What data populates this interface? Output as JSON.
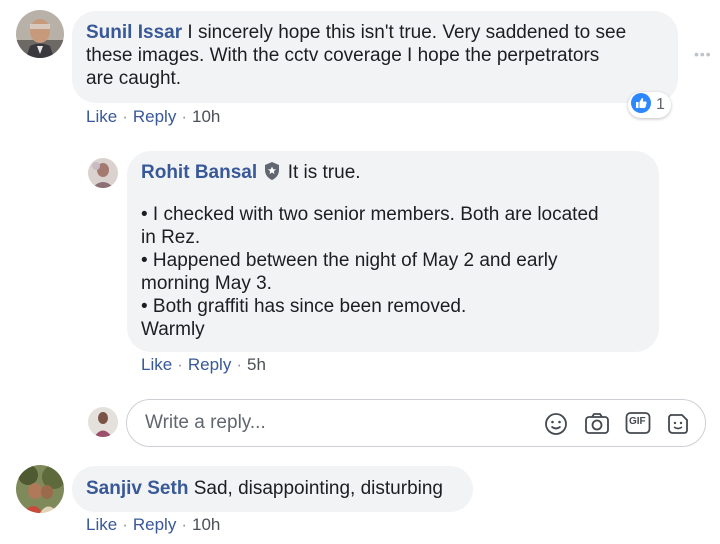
{
  "comments": [
    {
      "author": "Sunil Issar",
      "lines": [
        "I sincerely hope this isn't true. Very saddened to see",
        "these images. With the cctv coverage I hope the perpetrators",
        "are caught."
      ],
      "like": "Like",
      "reply": "Reply",
      "time": "10h",
      "reaction_count": "1"
    },
    {
      "author": "Sanjiv Seth",
      "text": "Sad, disappointing, disturbing",
      "like": "Like",
      "reply": "Reply",
      "time": "10h"
    }
  ],
  "reply": {
    "author": "Rohit Bansal",
    "first_text": "It is true.",
    "lines": [
      "• I checked with two senior members. Both are located",
      "in Rez.",
      "• Happened between the night of May 2 and early",
      "morning May 3.",
      "• Both graffiti has since been removed.",
      "Warmly"
    ],
    "like": "Like",
    "reply": "Reply",
    "time": "5h"
  },
  "reply_box": {
    "placeholder": "Write a reply...",
    "tools": [
      "emoji-icon",
      "camera-icon",
      "gif-icon",
      "sticker-icon"
    ],
    "gif_label": "GIF"
  },
  "colors": {
    "link": "#385898",
    "bubble": "#f2f3f5",
    "like_reaction": "#2d88ff"
  }
}
